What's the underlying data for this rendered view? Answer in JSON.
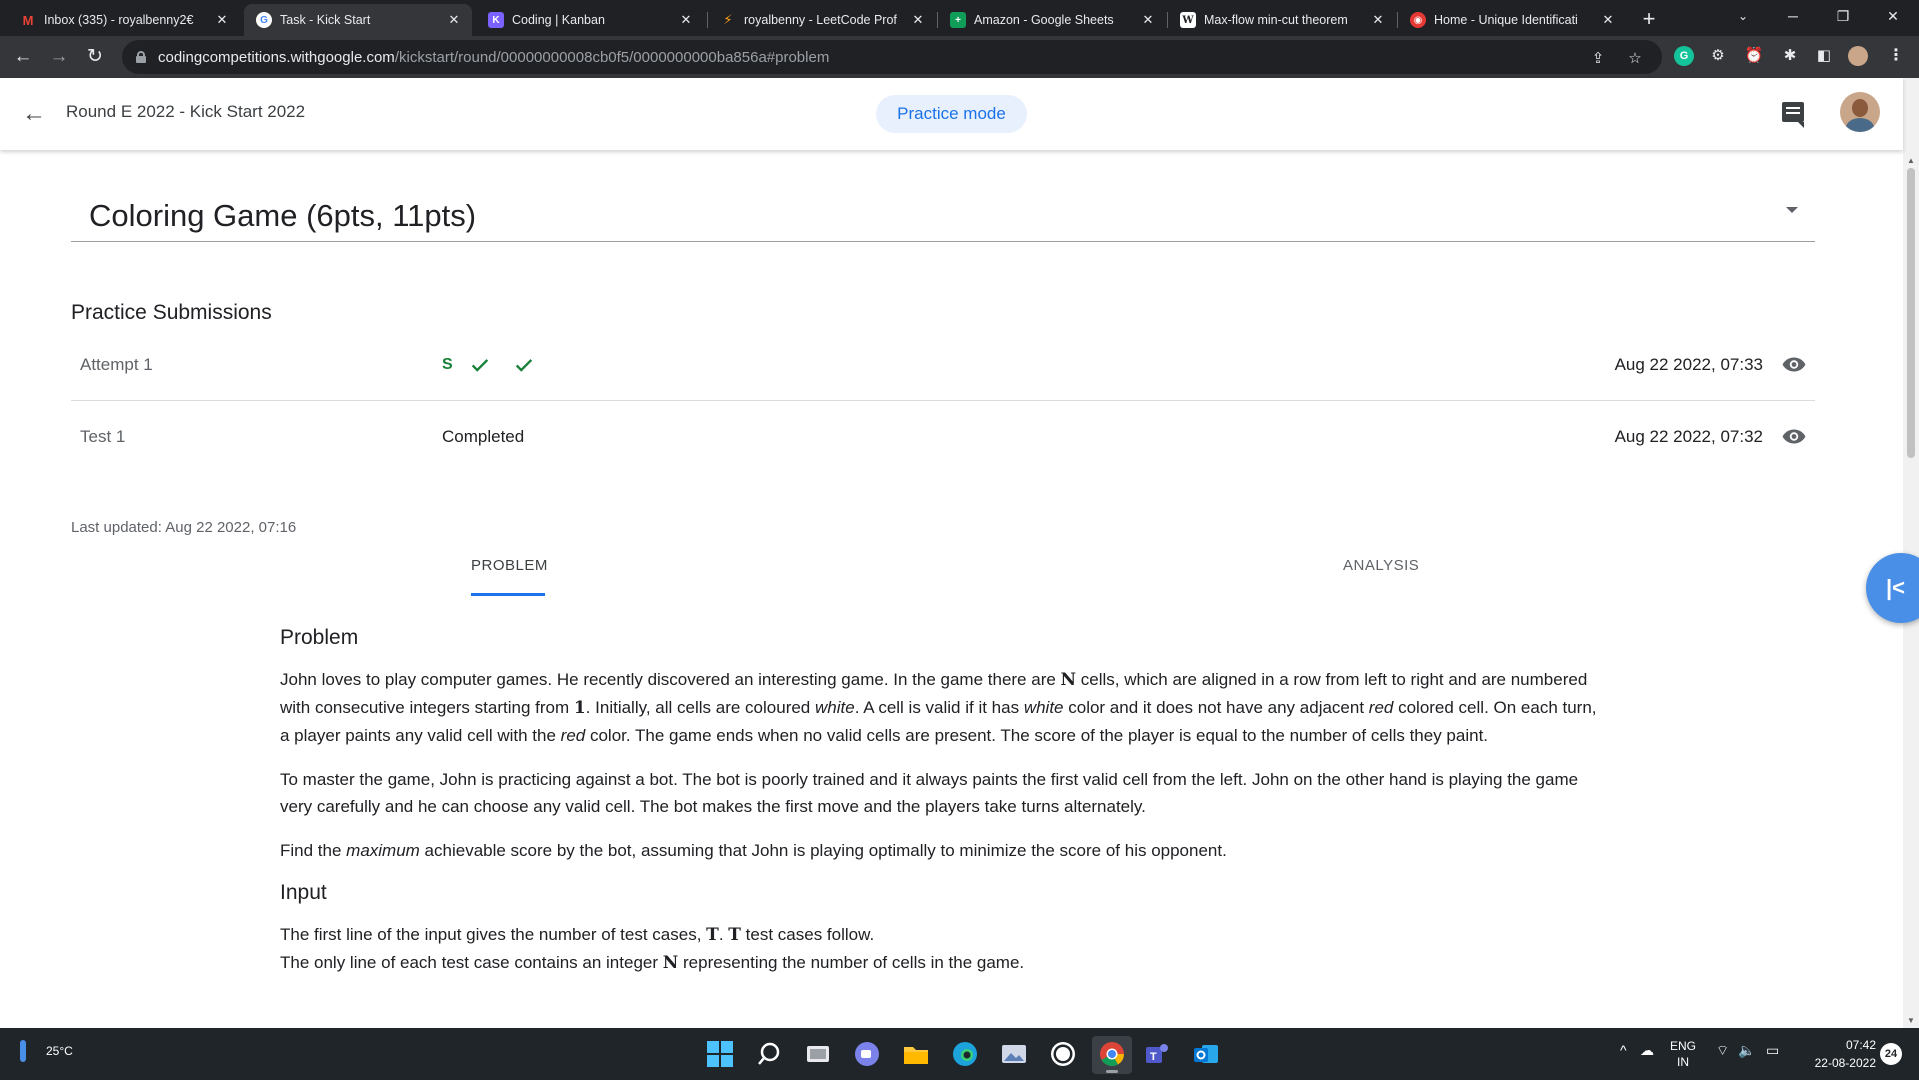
{
  "browser": {
    "tabs": [
      {
        "title": "Inbox (335) - royalbenny2€",
        "favicon": "gmail-icon",
        "color": "#ea4335",
        "glyph": "M"
      },
      {
        "title": "Task - Kick Start",
        "favicon": "google-icon",
        "color": "#4285f4",
        "glyph": "G",
        "active": true
      },
      {
        "title": "Coding | Kanban",
        "favicon": "kanban-icon",
        "color": "#7b61ff",
        "glyph": "K"
      },
      {
        "title": "royalbenny - LeetCode Prof",
        "favicon": "leetcode-icon",
        "color": "#ffa116",
        "glyph": "L"
      },
      {
        "title": "Amazon - Google Sheets",
        "favicon": "sheets-icon",
        "color": "#0f9d58",
        "glyph": "+"
      },
      {
        "title": "Max-flow min-cut theorem",
        "favicon": "wikipedia-icon",
        "color": "#ffffff",
        "glyph": "W"
      },
      {
        "title": "Home - Unique Identificati",
        "favicon": "uidai-icon",
        "color": "#e53935",
        "glyph": "U"
      }
    ],
    "url_host": "codingcompetitions.withgoogle.com",
    "url_path": "/kickstart/round/00000000008cb0f5/0000000000ba856a#problem"
  },
  "header": {
    "round_title": "Round E 2022 - Kick Start 2022",
    "practice_mode_label": "Practice mode"
  },
  "problem_selector": {
    "title": "Coloring Game (6pts, 11pts)"
  },
  "submissions": {
    "heading": "Practice Submissions",
    "rows": [
      {
        "name": "Attempt 1",
        "verdict_prefix": "S",
        "verdict_text": "",
        "date": "Aug 22 2022, 07:33"
      },
      {
        "name": "Test 1",
        "verdict_prefix": "",
        "verdict_text": "Completed",
        "date": "Aug 22 2022, 07:32"
      }
    ],
    "last_updated": "Last updated: Aug 22 2022, 07:16"
  },
  "nav_tabs": {
    "problem": "PROBLEM",
    "analysis": "ANALYSIS"
  },
  "statement": {
    "problem_heading": "Problem",
    "p1": {
      "a": "John loves to play computer games. He recently discovered an interesting game. In the game there are ",
      "n": "N",
      "b": " cells, which are aligned in a row from left to right and are numbered with consecutive integers starting from ",
      "one": "1",
      "c": ". Initially, all cells are coloured ",
      "white1": "white",
      "d": ". A cell is valid if it has ",
      "white2": "white",
      "e": " color and it does not have any adjacent ",
      "red1": "red",
      "f": " colored cell. On each turn, a player paints any valid cell with the ",
      "red2": "red",
      "g": " color. The game ends when no valid cells are present. The score of the player is equal to the number of cells they paint."
    },
    "p2": "To master the game, John is practicing against a bot. The bot is poorly trained and it always paints the first valid cell from the left. John on the other hand is playing the game very carefully and he can choose any valid cell. The bot makes the first move and the players take turns alternately.",
    "p3": {
      "a": "Find the ",
      "maximum": "maximum",
      "b": " achievable score by the bot, assuming that John is playing optimally to minimize the score of his opponent."
    },
    "input_heading": "Input",
    "input_line1": {
      "a": "The first line of the input gives the number of test cases, ",
      "t1": "T",
      "dot": ". ",
      "t2": "T",
      "b": " test cases follow."
    },
    "input_line2": {
      "a": "The only line of each test case contains an integer ",
      "n": "N",
      "b": " representing the number of cells in the game."
    }
  },
  "taskbar": {
    "temperature": "25°C",
    "lang_top": "ENG",
    "lang_bottom": "IN",
    "time": "07:42",
    "date": "22-08-2022",
    "notifications": "24"
  },
  "colors": {
    "accent": "#1a73e8",
    "success": "#188038",
    "chrome_dark": "#202124"
  }
}
